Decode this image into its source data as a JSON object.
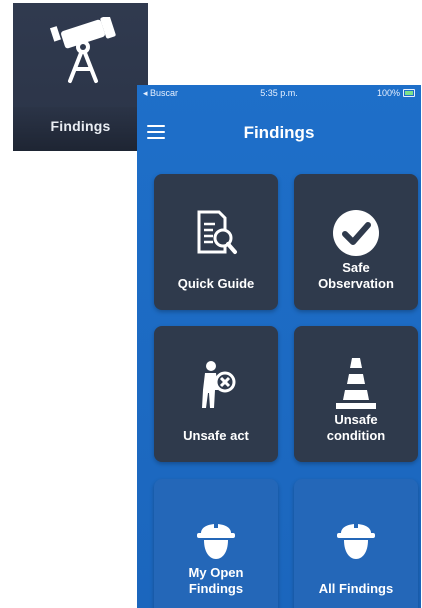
{
  "app_icon": {
    "label": "Findings"
  },
  "status_bar": {
    "carrier": "◂ Buscar",
    "time": "5:35 p.m.",
    "battery": "100%"
  },
  "header": {
    "title": "Findings"
  },
  "tiles": [
    {
      "label": "Quick Guide",
      "icon": "document-search-icon"
    },
    {
      "label": "Safe Observation",
      "icon": "checkmark-circle-icon"
    },
    {
      "label": "Unsafe act",
      "icon": "person-x-icon"
    },
    {
      "label": "Unsafe condition",
      "icon": "traffic-cone-icon"
    },
    {
      "label": "My Open Findings",
      "icon": "hard-hat-person-icon"
    },
    {
      "label": "All Findings",
      "icon": "hard-hat-person-icon"
    }
  ],
  "colors": {
    "screen": "#1e6fc9",
    "tile": "#2f3a4c",
    "tile_blue": "#2467b8"
  }
}
